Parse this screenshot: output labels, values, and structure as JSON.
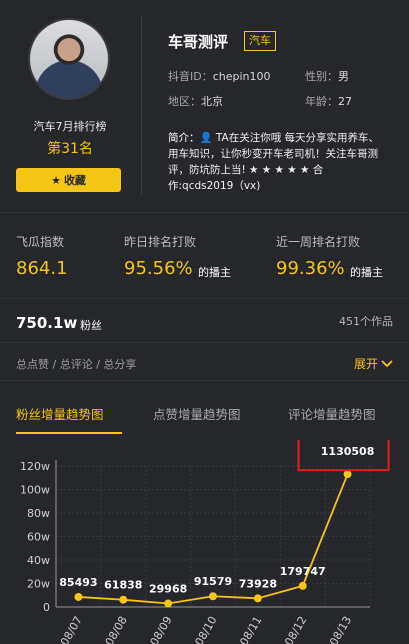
{
  "profile": {
    "name": "车哥测评",
    "category_tag": "汽车",
    "douyin_id_label": "抖音ID：",
    "douyin_id": "chepin100",
    "gender_label": "性别：",
    "gender": "男",
    "region_label": "地区：",
    "region": "北京",
    "age_label": "年龄：",
    "age": "27",
    "bio_label": "简介：",
    "bio_text": "TA在关注你哦 每天分享实用养车、用车知识，让你秒变开车老司机！关注车哥测评，防坑防上当! ★ ★ ★ ★ ★ 合作:qcds2019（vx)"
  },
  "rank": {
    "title": "汽车7月排行榜",
    "position": "第31名",
    "favorite_label": "收藏"
  },
  "stats": [
    {
      "label": "飞瓜指数",
      "value": "864.1",
      "suffix": ""
    },
    {
      "label": "昨日排名打败",
      "value": "95.56%",
      "suffix": "的播主"
    },
    {
      "label": "近一周排名打败",
      "value": "99.36%",
      "suffix": "的播主"
    }
  ],
  "fans": {
    "value": "750.1w",
    "label": "粉丝",
    "works": "451个作品"
  },
  "links": {
    "text": "总点赞 / 总评论 / 总分享",
    "expand": "展开"
  },
  "tabs": [
    "粉丝增量趋势图",
    "点赞增量趋势图",
    "评论增量趋势图"
  ],
  "colors": {
    "accent": "#f5c518",
    "background": "#26272b",
    "highlight_box": "#e02020"
  },
  "chart_data": {
    "type": "line",
    "x": [
      "08/07",
      "08/08",
      "08/09",
      "08/10",
      "08/11",
      "08/12",
      "08/13"
    ],
    "values": [
      85493,
      61838,
      29968,
      91579,
      73928,
      179747,
      1130508
    ],
    "data_labels": [
      "85493",
      "61838",
      "29968",
      "91579",
      "73928",
      "179747",
      "1130508"
    ],
    "y_ticks": [
      "0",
      "20w",
      "40w",
      "60w",
      "80w",
      "100w",
      "120w"
    ],
    "ylim": [
      0,
      1200000
    ],
    "grid": true,
    "highlighted_point": "1130508"
  }
}
